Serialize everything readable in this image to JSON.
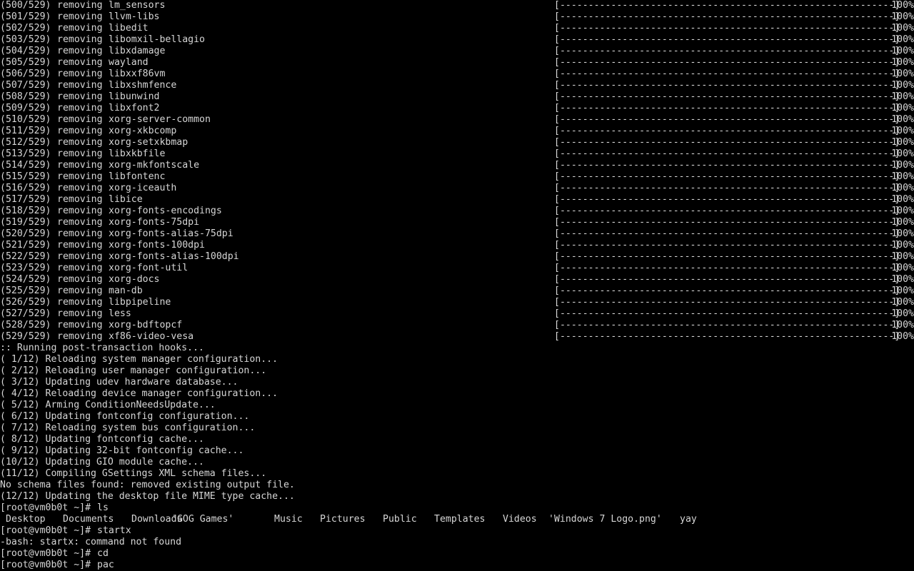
{
  "colors": {
    "background": "#000000",
    "foreground": "#d6d6d6"
  },
  "removal_lines": [
    {
      "counter": "(500/529)",
      "action": "removing",
      "package": "lm_sensors",
      "bar": "[-----------------------------------------------------------]",
      "percent": "100%"
    },
    {
      "counter": "(501/529)",
      "action": "removing",
      "package": "llvm-libs",
      "bar": "[-----------------------------------------------------------]",
      "percent": "100%"
    },
    {
      "counter": "(502/529)",
      "action": "removing",
      "package": "libedit",
      "bar": "[-----------------------------------------------------------]",
      "percent": "100%"
    },
    {
      "counter": "(503/529)",
      "action": "removing",
      "package": "libomxil-bellagio",
      "bar": "[-----------------------------------------------------------]",
      "percent": "100%"
    },
    {
      "counter": "(504/529)",
      "action": "removing",
      "package": "libxdamage",
      "bar": "[-----------------------------------------------------------]",
      "percent": "100%"
    },
    {
      "counter": "(505/529)",
      "action": "removing",
      "package": "wayland",
      "bar": "[-----------------------------------------------------------]",
      "percent": "100%"
    },
    {
      "counter": "(506/529)",
      "action": "removing",
      "package": "libxxf86vm",
      "bar": "[-----------------------------------------------------------]",
      "percent": "100%"
    },
    {
      "counter": "(507/529)",
      "action": "removing",
      "package": "libxshmfence",
      "bar": "[-----------------------------------------------------------]",
      "percent": "100%"
    },
    {
      "counter": "(508/529)",
      "action": "removing",
      "package": "libunwind",
      "bar": "[-----------------------------------------------------------]",
      "percent": "100%"
    },
    {
      "counter": "(509/529)",
      "action": "removing",
      "package": "libxfont2",
      "bar": "[-----------------------------------------------------------]",
      "percent": "100%"
    },
    {
      "counter": "(510/529)",
      "action": "removing",
      "package": "xorg-server-common",
      "bar": "[-----------------------------------------------------------]",
      "percent": "100%"
    },
    {
      "counter": "(511/529)",
      "action": "removing",
      "package": "xorg-xkbcomp",
      "bar": "[-----------------------------------------------------------]",
      "percent": "100%"
    },
    {
      "counter": "(512/529)",
      "action": "removing",
      "package": "xorg-setxkbmap",
      "bar": "[-----------------------------------------------------------]",
      "percent": "100%"
    },
    {
      "counter": "(513/529)",
      "action": "removing",
      "package": "libxkbfile",
      "bar": "[-----------------------------------------------------------]",
      "percent": "100%"
    },
    {
      "counter": "(514/529)",
      "action": "removing",
      "package": "xorg-mkfontscale",
      "bar": "[-----------------------------------------------------------]",
      "percent": "100%"
    },
    {
      "counter": "(515/529)",
      "action": "removing",
      "package": "libfontenc",
      "bar": "[-----------------------------------------------------------]",
      "percent": "100%"
    },
    {
      "counter": "(516/529)",
      "action": "removing",
      "package": "xorg-iceauth",
      "bar": "[-----------------------------------------------------------]",
      "percent": "100%"
    },
    {
      "counter": "(517/529)",
      "action": "removing",
      "package": "libice",
      "bar": "[-----------------------------------------------------------]",
      "percent": "100%"
    },
    {
      "counter": "(518/529)",
      "action": "removing",
      "package": "xorg-fonts-encodings",
      "bar": "[-----------------------------------------------------------]",
      "percent": "100%"
    },
    {
      "counter": "(519/529)",
      "action": "removing",
      "package": "xorg-fonts-75dpi",
      "bar": "[-----------------------------------------------------------]",
      "percent": "100%"
    },
    {
      "counter": "(520/529)",
      "action": "removing",
      "package": "xorg-fonts-alias-75dpi",
      "bar": "[-----------------------------------------------------------]",
      "percent": "100%"
    },
    {
      "counter": "(521/529)",
      "action": "removing",
      "package": "xorg-fonts-100dpi",
      "bar": "[-----------------------------------------------------------]",
      "percent": "100%"
    },
    {
      "counter": "(522/529)",
      "action": "removing",
      "package": "xorg-fonts-alias-100dpi",
      "bar": "[-----------------------------------------------------------]",
      "percent": "100%"
    },
    {
      "counter": "(523/529)",
      "action": "removing",
      "package": "xorg-font-util",
      "bar": "[-----------------------------------------------------------]",
      "percent": "100%"
    },
    {
      "counter": "(524/529)",
      "action": "removing",
      "package": "xorg-docs",
      "bar": "[-----------------------------------------------------------]",
      "percent": "100%"
    },
    {
      "counter": "(525/529)",
      "action": "removing",
      "package": "man-db",
      "bar": "[-----------------------------------------------------------]",
      "percent": "100%"
    },
    {
      "counter": "(526/529)",
      "action": "removing",
      "package": "libpipeline",
      "bar": "[-----------------------------------------------------------]",
      "percent": "100%"
    },
    {
      "counter": "(527/529)",
      "action": "removing",
      "package": "less",
      "bar": "[-----------------------------------------------------------]",
      "percent": "100%"
    },
    {
      "counter": "(528/529)",
      "action": "removing",
      "package": "xorg-bdftopcf",
      "bar": "[-----------------------------------------------------------]",
      "percent": "100%"
    },
    {
      "counter": "(529/529)",
      "action": "removing",
      "package": "xf86-video-vesa",
      "bar": "[-----------------------------------------------------------]",
      "percent": "100%"
    }
  ],
  "hooks_header": ":: Running post-transaction hooks...",
  "hook_lines": [
    "( 1/12) Reloading system manager configuration...",
    "( 2/12) Reloading user manager configuration...",
    "( 3/12) Updating udev hardware database...",
    "( 4/12) Reloading device manager configuration...",
    "( 5/12) Arming ConditionNeedsUpdate...",
    "( 6/12) Updating fontconfig configuration...",
    "( 7/12) Reloading system bus configuration...",
    "( 8/12) Updating fontconfig cache...",
    "( 9/12) Updating 32-bit fontconfig cache...",
    "(10/12) Updating GIO module cache...",
    "(11/12) Compiling GSettings XML schema files...",
    "No schema files found: removed existing output file.",
    "(12/12) Updating the desktop file MIME type cache..."
  ],
  "prompt": "[root@vm0b0t ~]#",
  "session": {
    "cmd_ls": "ls",
    "ls_output": [
      "Desktop",
      "Documents",
      "Downloads",
      "'GOG Games'",
      "Music",
      "Pictures",
      "Public",
      "Templates",
      "Videos",
      "'Windows 7 Logo.png'",
      "yay"
    ],
    "cmd_startx": "startx",
    "startx_error": "-bash: startx: command not found",
    "cmd_cd": "cd",
    "cmd_current": "pac"
  }
}
